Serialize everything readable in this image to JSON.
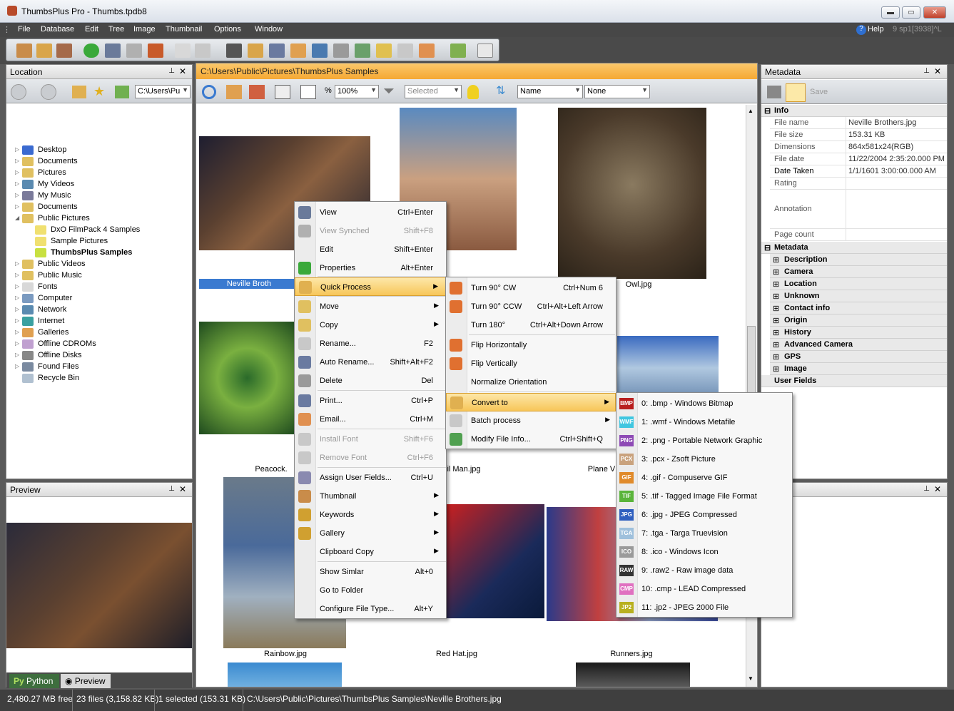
{
  "window": {
    "title": "ThumbsPlus Pro - Thumbs.tpdb8",
    "min": "▬",
    "max": "▭",
    "close": "✕"
  },
  "menu": [
    "File",
    "Database",
    "Edit",
    "Tree",
    "Image",
    "Thumbnail",
    "Options",
    "Window"
  ],
  "help": "Help",
  "version": "9 sp1[3938]^L",
  "location": {
    "title": "Location",
    "path": "C:\\Users\\Pu",
    "tree": [
      "Desktop",
      "Documents",
      "Pictures",
      "My Videos",
      "My Music",
      "Documents",
      "Public Pictures",
      "DxO FilmPack 4 Samples",
      "Sample Pictures",
      "ThumbsPlus Samples",
      "Public Videos",
      "Public Music",
      "Fonts",
      "Computer",
      "Network",
      "Internet",
      "Galleries",
      "Offline CDROMs",
      "Offline Disks",
      "Found Files",
      "Recycle Bin"
    ]
  },
  "preview": {
    "title": "Preview",
    "tabs": [
      "Python",
      "Preview"
    ]
  },
  "center": {
    "path": "C:\\Users\\Public\\Pictures\\ThumbsPlus Samples",
    "zoom": "100%",
    "filter": "Selected",
    "sort": "Name",
    "group": "None",
    "captions": [
      "Neville Broth",
      "Owl.jpg",
      "Peacock.",
      "il Man.jpg",
      "Plane V",
      "Rainbow.jpg",
      "Red Hat.jpg",
      "Runners.jpg"
    ]
  },
  "metadata": {
    "title": "Metadata",
    "save": "Save",
    "info": "Info",
    "rows": [
      [
        "File name",
        "Neville Brothers.jpg"
      ],
      [
        "File size",
        "153.31 KB"
      ],
      [
        "Dimensions",
        "864x581x24(RGB)"
      ],
      [
        "File date",
        "11/22/2004   2:35:20.000 PM"
      ],
      [
        "Date Taken",
        "1/1/1601   3:00:00.000 AM"
      ],
      [
        "Rating",
        ""
      ],
      [
        "Annotation",
        ""
      ],
      [
        "Page count",
        ""
      ]
    ],
    "group": "Metadata",
    "groups": [
      "Description",
      "Camera",
      "Location",
      "Unknown",
      "Contact info",
      "Origin",
      "History",
      "Advanced Camera",
      "GPS",
      "Image"
    ],
    "userfields": "User Fields"
  },
  "ctx": [
    {
      "l": "View",
      "s": "Ctrl+Enter"
    },
    {
      "l": "View Synched",
      "s": "Shift+F8",
      "d": true
    },
    {
      "l": "Edit",
      "s": "Shift+Enter"
    },
    {
      "l": "Properties",
      "s": "Alt+Enter"
    },
    {
      "l": "Quick Process",
      "s": ""
    },
    {
      "l": "Move",
      "s": ""
    },
    {
      "l": "Copy",
      "s": ""
    },
    {
      "l": "Rename...",
      "s": "F2"
    },
    {
      "l": "Auto Rename...",
      "s": "Shift+Alt+F2"
    },
    {
      "l": "Delete",
      "s": "Del"
    },
    {
      "l": "Print...",
      "s": "Ctrl+P"
    },
    {
      "l": "Email...",
      "s": "Ctrl+M"
    },
    {
      "l": "Install Font",
      "s": "Shift+F6",
      "d": true
    },
    {
      "l": "Remove Font",
      "s": "Ctrl+F6",
      "d": true
    },
    {
      "l": "Assign User Fields...",
      "s": "Ctrl+U"
    },
    {
      "l": "Thumbnail",
      "s": ""
    },
    {
      "l": "Keywords",
      "s": ""
    },
    {
      "l": "Gallery",
      "s": ""
    },
    {
      "l": "Clipboard Copy",
      "s": ""
    },
    {
      "l": "Show Simlar",
      "s": "Alt+0"
    },
    {
      "l": "Go to Folder",
      "s": ""
    },
    {
      "l": "Configure File Type...",
      "s": "Alt+Y"
    }
  ],
  "qp": [
    {
      "l": "Turn 90° CW",
      "s": "Ctrl+Num 6"
    },
    {
      "l": "Turn 90° CCW",
      "s": "Ctrl+Alt+Left Arrow"
    },
    {
      "l": "Turn 180°",
      "s": "Ctrl+Alt+Down Arrow"
    },
    {
      "l": "Flip Horizontally",
      "s": ""
    },
    {
      "l": "Flip Vertically",
      "s": ""
    },
    {
      "l": "Normalize Orientation",
      "s": ""
    },
    {
      "l": "Convert to",
      "s": ""
    },
    {
      "l": "Batch process",
      "s": ""
    },
    {
      "l": "Modify File Info...",
      "s": "Ctrl+Shift+Q"
    }
  ],
  "conv": [
    {
      "t": "BMP",
      "l": "0: .bmp - Windows Bitmap",
      "c": "#b81e1e"
    },
    {
      "t": "WMF",
      "l": "1: .wmf - Windows Metafile",
      "c": "#3fc6e0"
    },
    {
      "t": "PNG",
      "l": "2: .png - Portable Network Graphic",
      "c": "#8e4ab5"
    },
    {
      "t": "PCX",
      "l": "3: .pcx - Zsoft Picture",
      "c": "#c9a27d"
    },
    {
      "t": "GIF",
      "l": "4: .gif - Compuserve GIF",
      "c": "#e08a2a"
    },
    {
      "t": "TIF",
      "l": "5: .tif - Tagged Image File Format",
      "c": "#5ab43a"
    },
    {
      "t": "JPG",
      "l": "6: .jpg - JPEG Compressed",
      "c": "#2f5fbf"
    },
    {
      "t": "TGA",
      "l": "7: .tga - Targa Truevision",
      "c": "#9fc0dc"
    },
    {
      "t": "ICO",
      "l": "8: .ico - Windows Icon",
      "c": "#9a9a9a"
    },
    {
      "t": "RAW",
      "l": "9: .raw2 - Raw image data",
      "c": "#333333"
    },
    {
      "t": "CMP",
      "l": "10: .cmp - LEAD Compressed",
      "c": "#e070c0"
    },
    {
      "t": "JP2",
      "l": "11: .jp2 - JPEG 2000 File",
      "c": "#b8b020"
    }
  ],
  "status": {
    "free": "2,480.27 MB free",
    "files": "23 files (3,158.82 KB)",
    "sel": "1 selected (153.31 KB)",
    "path": "C:\\Users\\Public\\Pictures\\ThumbsPlus Samples\\Neville Brothers.jpg"
  }
}
